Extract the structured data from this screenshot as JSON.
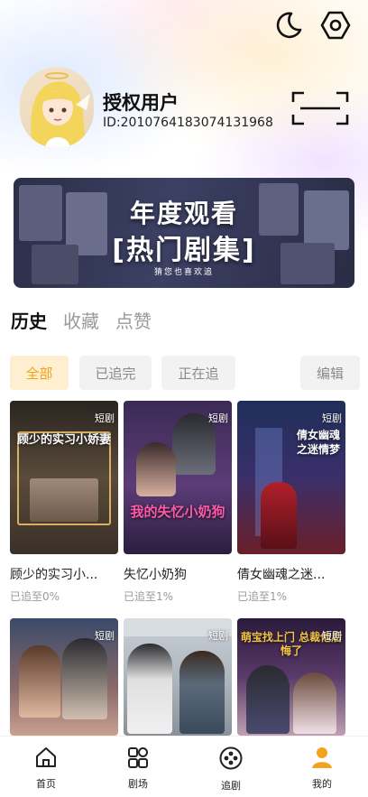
{
  "header": {
    "icons": [
      "moon-icon",
      "settings-icon"
    ]
  },
  "profile": {
    "username": "授权用户",
    "user_id": "ID:2010764183074131968",
    "scan_icon": "scan-icon"
  },
  "banner": {
    "title_line1": "年度观看",
    "title_line2": "[热门剧集]",
    "subtitle": "猜您也喜欢追"
  },
  "tabs": [
    {
      "label": "历史",
      "active": true
    },
    {
      "label": "收藏",
      "active": false
    },
    {
      "label": "点赞",
      "active": false
    }
  ],
  "filters": [
    {
      "label": "全部",
      "active": true
    },
    {
      "label": "已追完",
      "active": false
    },
    {
      "label": "正在追",
      "active": false
    }
  ],
  "edit_label": "编辑",
  "dramas": [
    {
      "title": "顾少的实习小...",
      "progress": "已追至0%",
      "tag": "短剧",
      "poster_text": "顾少的实习小娇妻",
      "accent": "#d9b063"
    },
    {
      "title": "失忆小奶狗",
      "progress": "已追至1%",
      "tag": "短剧",
      "poster_text": "我的失忆小奶狗",
      "accent": "#ff5aa7"
    },
    {
      "title": "倩女幽魂之迷...",
      "progress": "已追至1%",
      "tag": "短剧",
      "poster_text": "倩女幽魂之迷情梦",
      "accent": "#ffffff"
    },
    {
      "title": "",
      "progress": "",
      "tag": "短剧",
      "poster_text": "",
      "accent": "#ffffff"
    },
    {
      "title": "",
      "progress": "",
      "tag": "短剧",
      "poster_text": "",
      "accent": "#ffffff"
    },
    {
      "title": "",
      "progress": "",
      "tag": "短剧",
      "poster_text": "萌宝找上门 总裁他后悔了",
      "accent": "#f4c542"
    }
  ],
  "bottom_nav": [
    {
      "label": "首页",
      "icon": "home-icon",
      "active": false
    },
    {
      "label": "剧场",
      "icon": "theater-icon",
      "active": false
    },
    {
      "label": "追剧",
      "icon": "follow-icon",
      "active": false
    },
    {
      "label": "我的",
      "icon": "profile-icon",
      "active": true
    }
  ],
  "colors": {
    "accent": "#f3a21b",
    "chip_active_bg": "#fdefcf"
  }
}
